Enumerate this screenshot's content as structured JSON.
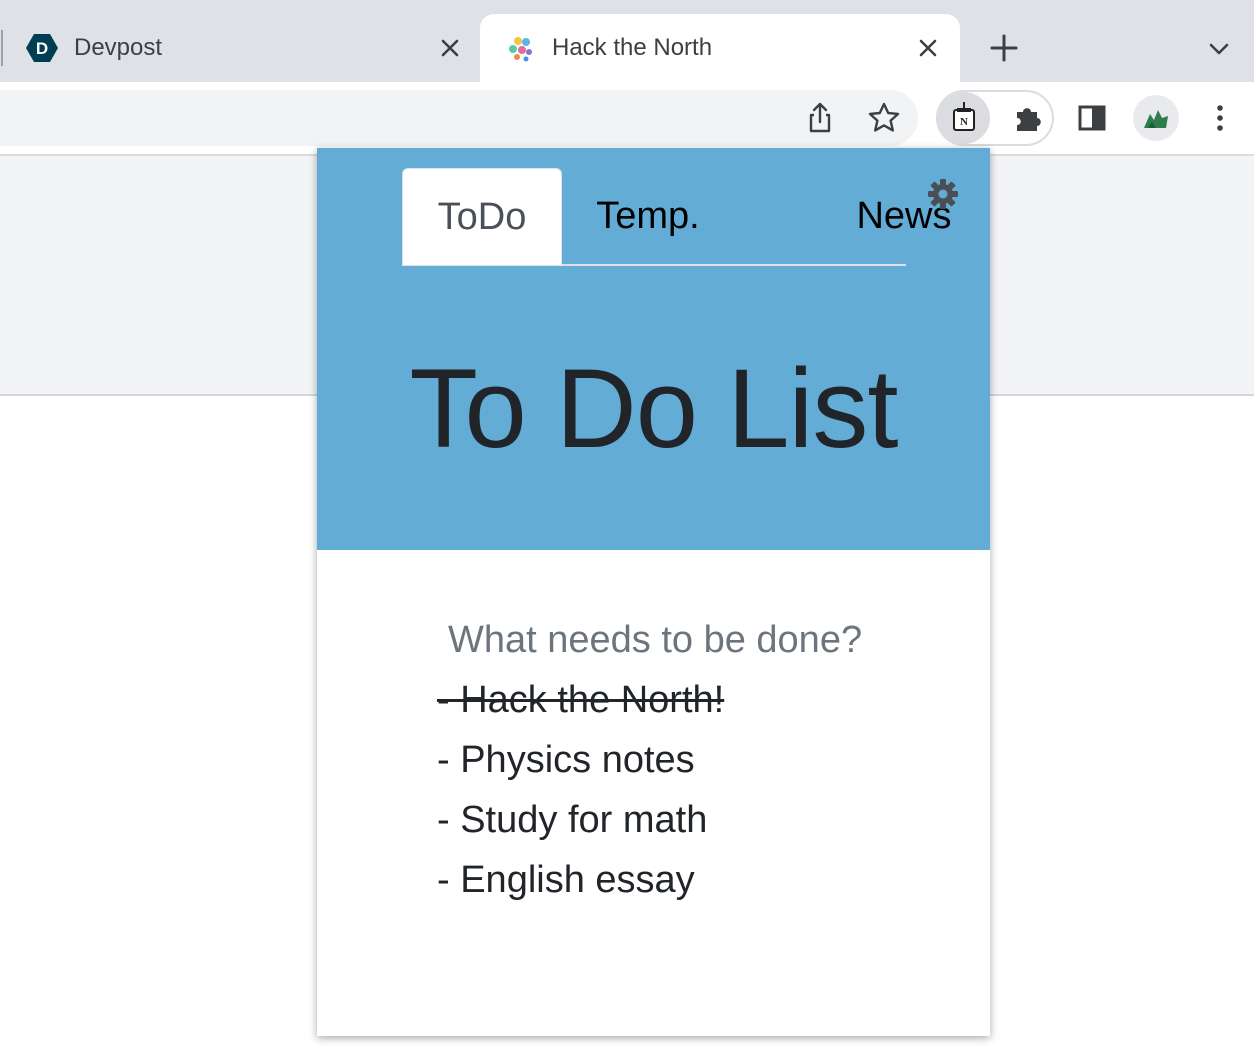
{
  "browser": {
    "tabs": [
      {
        "title": "Devpost",
        "favicon": "devpost-icon",
        "active": false
      },
      {
        "title": "Hack the North",
        "favicon": "hack-the-north-icon",
        "active": true
      }
    ],
    "toolbar_icons": [
      "share-icon",
      "bookmark-star-icon",
      "notion-extension-icon",
      "extensions-puzzle-icon",
      "side-panel-icon",
      "profile-avatar",
      "kebab-menu-icon"
    ]
  },
  "popup": {
    "tabs": [
      {
        "label": "ToDo",
        "active": true
      },
      {
        "label": "Temp.",
        "active": false
      },
      {
        "label": "News",
        "active": false
      }
    ],
    "title": "To Do List",
    "input_placeholder": "What needs to be done?",
    "todos": [
      {
        "text": "- Hack the North!",
        "done": true
      },
      {
        "text": "- Physics notes",
        "done": false
      },
      {
        "text": "- Study for math",
        "done": false
      },
      {
        "text": "- English essay",
        "done": false
      }
    ],
    "colors": {
      "header": "#62acd6",
      "title_text": "#212529"
    }
  }
}
